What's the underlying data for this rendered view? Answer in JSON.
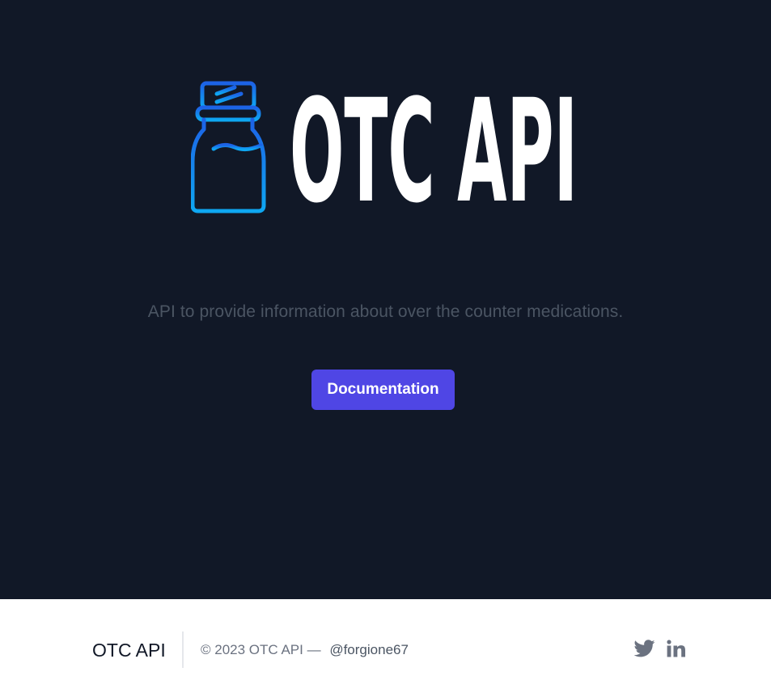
{
  "hero": {
    "logo_text": "OTC API",
    "tagline": "API to provide information about over the counter medications.",
    "documentation_label": "Documentation"
  },
  "footer": {
    "brand": "OTC API",
    "copyright": "© 2023 OTC API —",
    "handle": "@forgione67",
    "social_icons": [
      "twitter-icon",
      "linkedin-icon"
    ]
  },
  "colors": {
    "hero_background": "#111827",
    "logo_gradient_top": "#1d6fe8",
    "logo_gradient_bottom": "#0ea5f0",
    "button_background": "#4f46e5",
    "tagline": "#4b5563",
    "footer_background": "#ffffff",
    "footer_icon": "#6b7280"
  }
}
